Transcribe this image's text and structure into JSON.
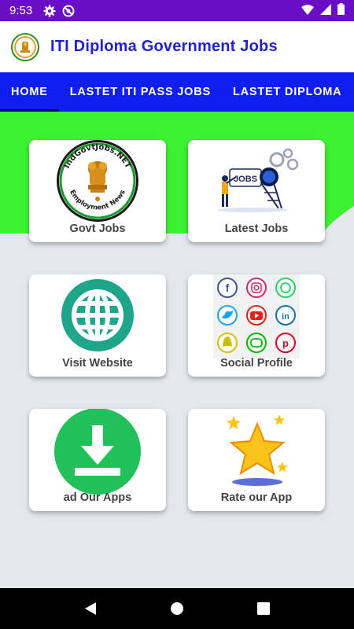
{
  "status": {
    "time": "9:53"
  },
  "app": {
    "title": "ITI Diploma Government Jobs"
  },
  "tabs": [
    {
      "label": "HOME",
      "active": true
    },
    {
      "label": "LASTET ITI PASS JOBS",
      "active": false
    },
    {
      "label": "LASTET DIPLOMA",
      "active": false
    }
  ],
  "cards": [
    {
      "label": "Govt Jobs"
    },
    {
      "label": "Latest Jobs",
      "image_text": "JOBS"
    },
    {
      "label": "Visit Website"
    },
    {
      "label": "Social Profile"
    },
    {
      "label": "ad Our Apps"
    },
    {
      "label": "Rate our App"
    }
  ],
  "logo": {
    "ring_top": "IndGovtJobs.NET",
    "ring_bottom": "Employment News"
  },
  "colors": {
    "status_bar": "#6a0dc7",
    "app_title": "#1f1fd6",
    "tab_bar": "#0f1ff0",
    "green_header": "#3cf032",
    "globe": "#1ea58a",
    "download": "#22c05a"
  },
  "icons": {
    "status": [
      "gear-icon",
      "at-icon",
      "wifi-icon",
      "signal-icon",
      "battery-icon"
    ],
    "nav": [
      "back-icon",
      "home-icon",
      "recents-icon"
    ]
  }
}
